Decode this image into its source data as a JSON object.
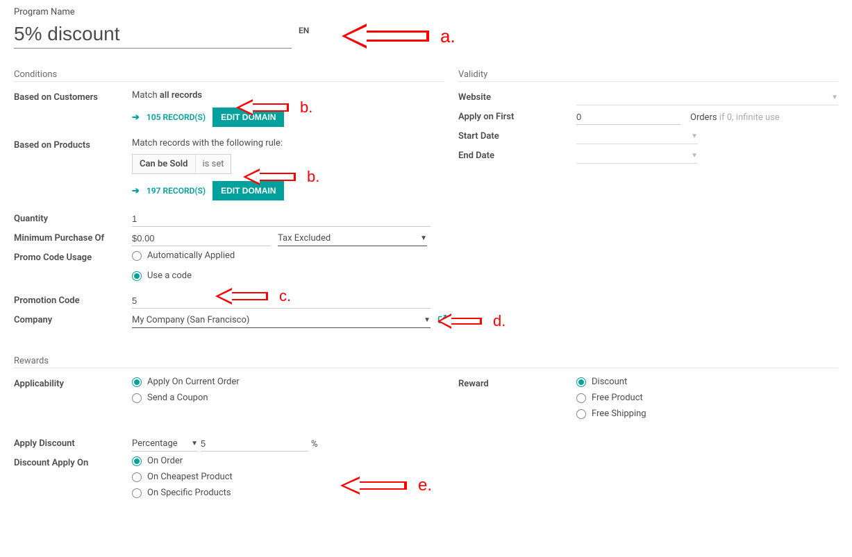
{
  "header": {
    "program_name_label": "Program Name",
    "program_name_value": "5% discount",
    "lang_badge": "EN"
  },
  "conditions": {
    "title": "Conditions",
    "customers_label": "Based on Customers",
    "customers_match_prefix": "Match ",
    "customers_match_bold": "all records",
    "customers_records": "105 RECORD(S)",
    "products_label": "Based on Products",
    "products_match_text": "Match records with the following rule:",
    "products_chip_field": "Can be Sold",
    "products_chip_op": "is set",
    "products_records": "197 RECORD(S)",
    "edit_domain_btn": "EDIT DOMAIN",
    "quantity_label": "Quantity",
    "quantity_value": "1",
    "min_purchase_label": "Minimum Purchase Of",
    "min_purchase_value": "$0.00",
    "tax_excluded": "Tax Excluded",
    "promo_usage_label": "Promo Code Usage",
    "promo_usage_options": [
      "Automatically Applied",
      "Use a code"
    ],
    "promo_usage_selected": 1,
    "promotion_code_label": "Promotion Code",
    "promotion_code_value": "5",
    "company_label": "Company",
    "company_value": "My Company (San Francisco)"
  },
  "validity": {
    "title": "Validity",
    "website_label": "Website",
    "apply_first_label": "Apply on First",
    "apply_first_value": "0",
    "apply_first_hint_prefix": "Orders",
    "apply_first_hint_suffix": " if 0, infinite use",
    "start_date_label": "Start Date",
    "end_date_label": "End Date"
  },
  "rewards": {
    "title": "Rewards",
    "applicability_label": "Applicability",
    "applicability_options": [
      "Apply On Current Order",
      "Send a Coupon"
    ],
    "applicability_selected": 0,
    "reward_label": "Reward",
    "reward_options": [
      "Discount",
      "Free Product",
      "Free Shipping"
    ],
    "reward_selected": 0,
    "apply_discount_label": "Apply Discount",
    "apply_discount_type": "Percentage",
    "apply_discount_value": "5",
    "apply_discount_unit": "%",
    "discount_apply_on_label": "Discount Apply On",
    "discount_apply_on_options": [
      "On Order",
      "On Cheapest Product",
      "On Specific Products"
    ],
    "discount_apply_on_selected": 0
  },
  "annotations": {
    "a": "a.",
    "b": "b.",
    "c": "c.",
    "d": "d.",
    "e": "e."
  }
}
